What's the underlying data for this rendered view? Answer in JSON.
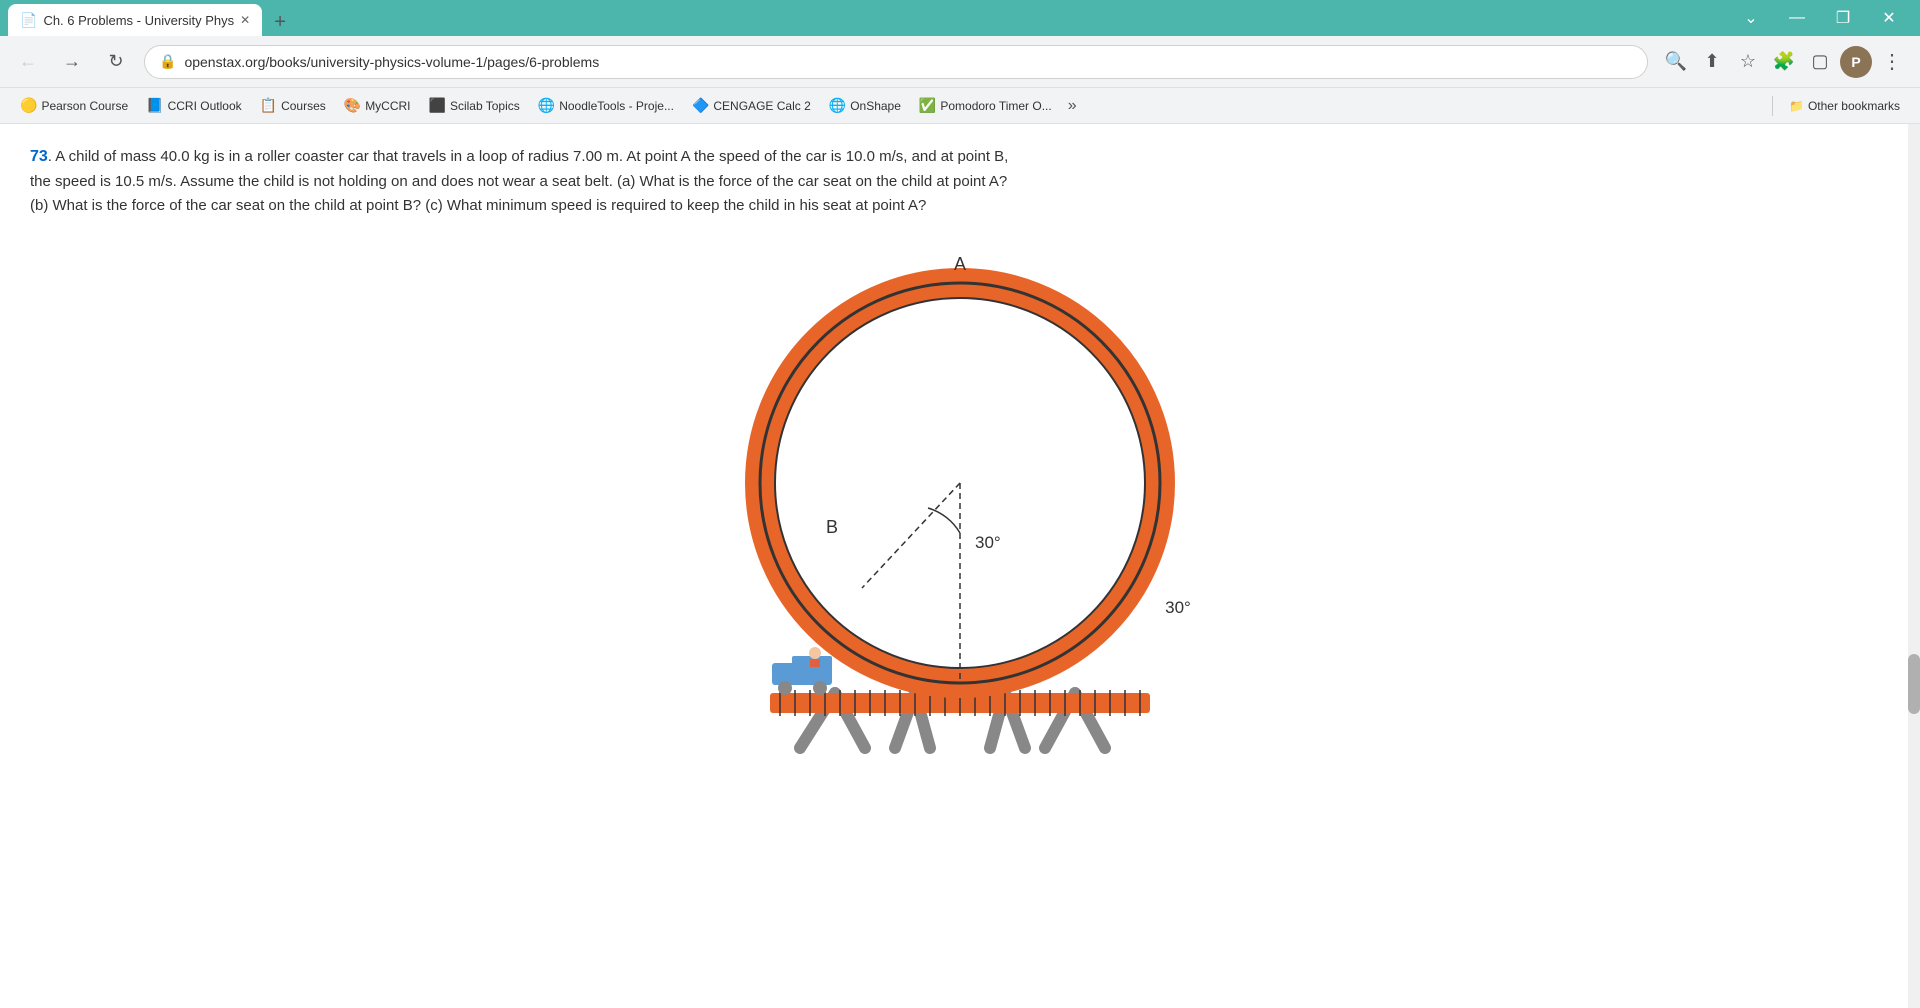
{
  "browser": {
    "tab_title": "Ch. 6 Problems - University Phys",
    "tab_favicon": "📄",
    "url": "openstax.org/books/university-physics-volume-1/pages/6-problems",
    "new_tab_label": "+",
    "win_minimize": "—",
    "win_maximize": "❐",
    "win_close": "✕",
    "nav_back": "←",
    "nav_forward": "→",
    "nav_reload": "↻",
    "addr_lock": "🔒"
  },
  "bookmarks": [
    {
      "id": "pearson",
      "label": "Pearson Course",
      "icon": "🟡"
    },
    {
      "id": "ccri-outlook",
      "label": "CCRI Outlook",
      "icon": "📘"
    },
    {
      "id": "courses",
      "label": "Courses",
      "icon": "📋"
    },
    {
      "id": "myccri",
      "label": "MyCCRI",
      "icon": "🎨"
    },
    {
      "id": "scilab",
      "label": "Scilab Topics",
      "icon": "⬛"
    },
    {
      "id": "noodletools",
      "label": "NoodleTools - Proje...",
      "icon": "🌐"
    },
    {
      "id": "cengage",
      "label": "CENGAGE Calc 2",
      "icon": "🔷"
    },
    {
      "id": "onshape",
      "label": "OnShape",
      "icon": "🌐"
    },
    {
      "id": "pomodoro",
      "label": "Pomodoro Timer O...",
      "icon": "✅"
    }
  ],
  "bookmarks_more": "»",
  "bookmarks_folder": "Other bookmarks",
  "problem": {
    "number": "73",
    "text": ". A child of mass 40.0 kg is in a roller coaster car that travels in a loop of radius 7.00 m. At point A the speed of the car is 10.0 m/s, and at point B, the speed is 10.5 m/s. Assume the child is not holding on and does not wear a seat belt. (a) What is the force of the car seat on the child at point A? (b) What is the force of the car seat on the child at point B? (c) What minimum speed is required to keep the child in his seat at point A?"
  },
  "diagram": {
    "point_a_label": "A",
    "point_b_label": "B",
    "angle_label": "30°"
  }
}
